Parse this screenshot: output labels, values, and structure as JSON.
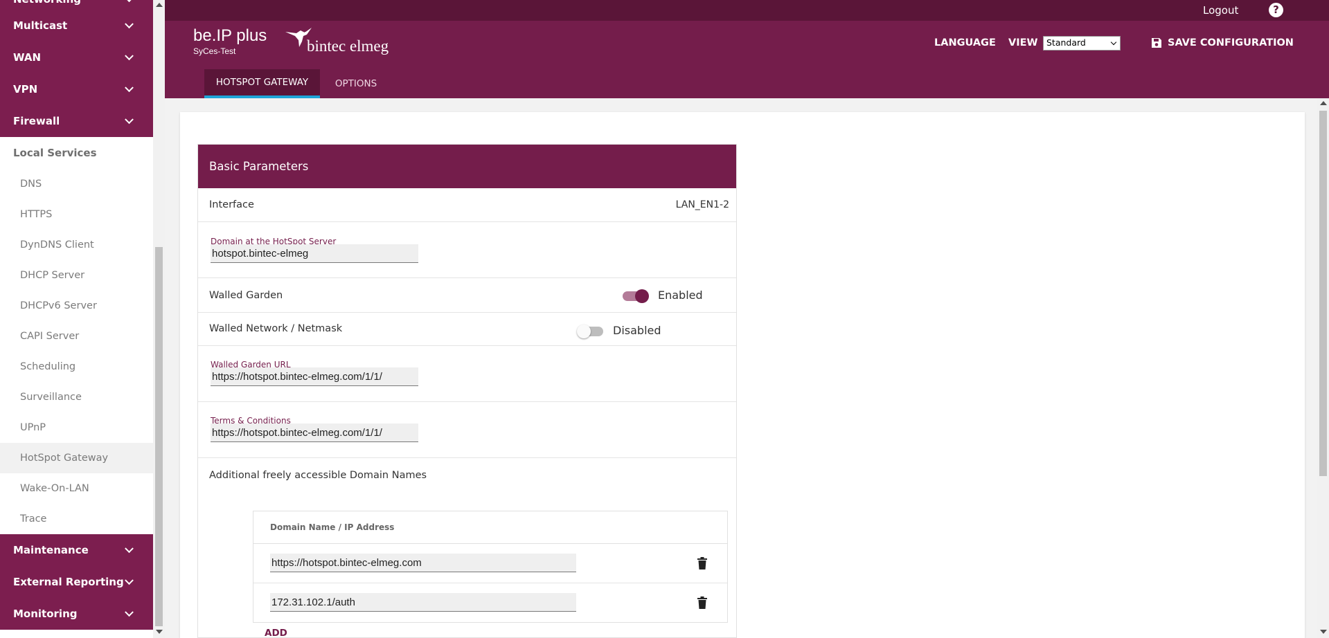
{
  "sidebar": {
    "sections_top": [
      {
        "label": "Networking"
      },
      {
        "label": "Multicast"
      },
      {
        "label": "WAN"
      },
      {
        "label": "VPN"
      },
      {
        "label": "Firewall"
      }
    ],
    "local_services": {
      "label": "Local Services",
      "items": [
        {
          "label": "DNS"
        },
        {
          "label": "HTTPS"
        },
        {
          "label": "DynDNS Client"
        },
        {
          "label": "DHCP Server"
        },
        {
          "label": "DHCPv6 Server"
        },
        {
          "label": "CAPI Server"
        },
        {
          "label": "Scheduling"
        },
        {
          "label": "Surveillance"
        },
        {
          "label": "UPnP"
        },
        {
          "label": "HotSpot Gateway"
        },
        {
          "label": "Wake-On-LAN"
        },
        {
          "label": "Trace"
        }
      ],
      "active_item": "HotSpot Gateway"
    },
    "sections_bottom": [
      {
        "label": "Maintenance"
      },
      {
        "label": "External Reporting"
      },
      {
        "label": "Monitoring"
      }
    ]
  },
  "header": {
    "logout": "Logout",
    "help": "?",
    "product": "be.IP plus",
    "device": "SyCes-Test",
    "logo": "bintec elmeg",
    "language": "LANGUAGE",
    "view_label": "VIEW",
    "view_value": "Standard",
    "save": "SAVE CONFIGURATION",
    "tabs": [
      {
        "label": "HOTSPOT GATEWAY",
        "active": true
      },
      {
        "label": "OPTIONS",
        "active": false
      }
    ]
  },
  "panel": {
    "title": "Basic Parameters",
    "interface": {
      "label": "Interface",
      "value": "LAN_EN1-2"
    },
    "domain": {
      "label": "Domain at the HotSpot Server",
      "value": "hotspot.bintec-elmeg"
    },
    "walled_garden": {
      "label": "Walled Garden",
      "state": "Enabled"
    },
    "walled_network": {
      "label": "Walled Network / Netmask",
      "state": "Disabled"
    },
    "walled_url": {
      "label": "Walled Garden URL",
      "value": "https://hotspot.bintec-elmeg.com/1/1/"
    },
    "terms": {
      "label": "Terms & Conditions",
      "value": "https://hotspot.bintec-elmeg.com/1/1/"
    },
    "additional": {
      "label": "Additional freely accessible Domain Names",
      "column": "Domain Name / IP Address",
      "rows": [
        {
          "value": "https://hotspot.bintec-elmeg.com"
        },
        {
          "value": "172.31.102.1/auth"
        }
      ],
      "add": "ADD"
    }
  },
  "colors": {
    "brand": "#741d4b",
    "topbar": "#5a1538",
    "tab_underline": "#1ea5d8"
  }
}
